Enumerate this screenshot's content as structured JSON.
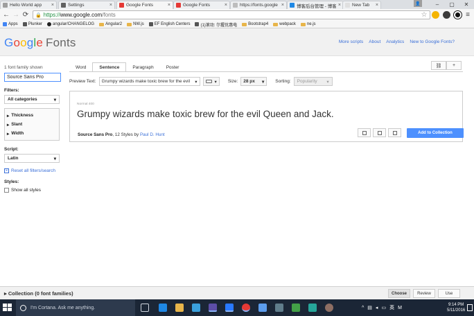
{
  "browser": {
    "tabs": [
      {
        "title": "Hello World app",
        "favicon_color": "#9e9e9e"
      },
      {
        "title": "Settings",
        "favicon_color": "#616161"
      },
      {
        "title": "Google Fonts",
        "favicon_color": "#e53935"
      },
      {
        "title": "Google Fonts",
        "favicon_color": "#e53935"
      },
      {
        "title": "https://fonts.google",
        "favicon_color": "#bdbdbd"
      },
      {
        "title": "博客后台管理 - 博客",
        "favicon_color": "#1e88e5"
      },
      {
        "title": "New Tab",
        "favicon_color": "#e0e0e0"
      }
    ],
    "active_tab_index": 2,
    "close_glyph": "×",
    "url_scheme": "https://",
    "url_host": "www.google.com",
    "url_path": "/fonts",
    "bookmarks": [
      {
        "label": "Apps",
        "kind": "apps"
      },
      {
        "label": "Plunker",
        "kind": "page"
      },
      {
        "label": "angular/CHANGELOG",
        "kind": "github"
      },
      {
        "label": "Angular2",
        "kind": "folder"
      },
      {
        "label": "NW.js",
        "kind": "folder"
      },
      {
        "label": "EF English Centers",
        "kind": "page"
      },
      {
        "label": "(1)滚动: 尔握优惠电",
        "kind": "page"
      },
      {
        "label": "Bootstrap4",
        "kind": "folder"
      },
      {
        "label": "webpack",
        "kind": "folder"
      },
      {
        "label": "ne.js",
        "kind": "folder"
      }
    ]
  },
  "header": {
    "logo_word": "Google",
    "logo_product": "Fonts",
    "logo_colors": [
      "#4285f4",
      "#ea4335",
      "#fbbc05",
      "#4285f4",
      "#34a853",
      "#ea4335"
    ],
    "links": [
      "More scripts",
      "About",
      "Analytics",
      "New to Google Fonts?"
    ]
  },
  "sidebar": {
    "count_text": "1 font family shown",
    "search_value": "Source Sans Pro",
    "filters_label": "Filters:",
    "category": "All categories",
    "accordion": [
      "Thickness",
      "Slant",
      "Width"
    ],
    "script_label": "Script:",
    "script_value": "Latin",
    "reset_label": "Reset all filters/search",
    "styles_label": "Styles:",
    "show_all_label": "Show all styles"
  },
  "view_tabs": [
    {
      "label": "Word",
      "active": false
    },
    {
      "label": "Sentence",
      "active": true
    },
    {
      "label": "Paragraph",
      "active": false
    },
    {
      "label": "Poster",
      "active": false
    }
  ],
  "controls": {
    "preview_label": "Preview Text:",
    "preview_value": "Grumpy wizards make toxic brew for the evil",
    "size_label": "Size:",
    "size_value": "28 px",
    "sorting_label": "Sorting:",
    "sorting_value": "Popularity"
  },
  "font_card": {
    "style_tag": "Normal 400",
    "sample_text": "Grumpy wizards make toxic brew for the evil Queen and Jack.",
    "family": "Source Sans Pro",
    "styles_text": ", 12 Styles by ",
    "author": "Paul D. Hunt",
    "add_button": "Add to Collection"
  },
  "collection": {
    "title": "Collection (0 font families)",
    "buttons": [
      {
        "label": "Choose",
        "active": true
      },
      {
        "label": "Review",
        "active": false
      },
      {
        "label": "Use",
        "active": false
      }
    ]
  },
  "taskbar": {
    "cortana_text": "I'm Cortana. Ask me anything.",
    "tray_lang": "英",
    "tray_ime": "M",
    "time": "9:14 PM",
    "date": "5/11/2016"
  }
}
